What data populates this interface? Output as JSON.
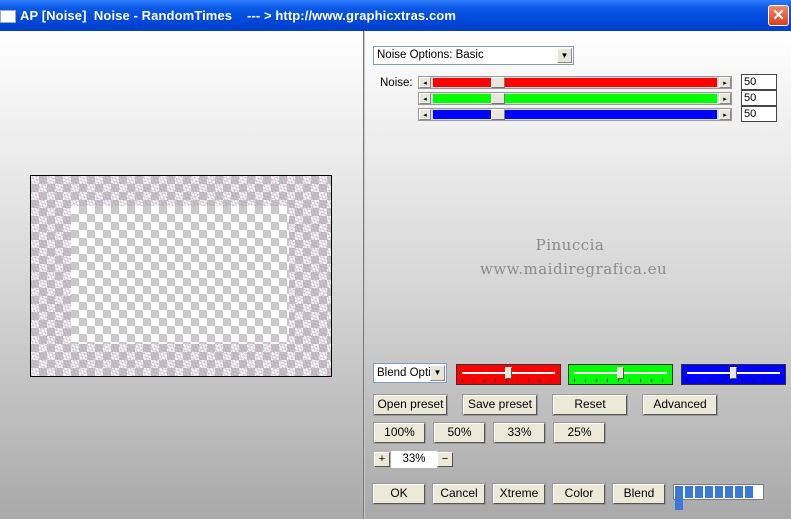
{
  "window": {
    "title": "AP [Noise]  Noise - RandomTimes    --- > http://www.graphicxtras.com",
    "close_symbol": "✕"
  },
  "noise_options": {
    "selected": "Noise Options: Basic"
  },
  "noise": {
    "label": "Noise:",
    "channels": [
      {
        "name": "red",
        "color": "#ff0000",
        "value": "50",
        "level": 0.22
      },
      {
        "name": "green",
        "color": "#00ff00",
        "value": "50",
        "level": 0.22
      },
      {
        "name": "blue",
        "color": "#0000ff",
        "value": "50",
        "level": 0.22
      }
    ]
  },
  "watermark": {
    "line1": "Pinuccia",
    "line2": "www.maidiregrafica.eu"
  },
  "blend_options": {
    "selected": "Blend Opti"
  },
  "color_sliders": [
    {
      "color": "#ff0000",
      "level": 0.5
    },
    {
      "color": "#00ff00",
      "level": 0.5
    },
    {
      "color": "#0000ff",
      "level": 0.5
    }
  ],
  "preset_buttons": {
    "open": "Open preset",
    "save": "Save preset",
    "reset": "Reset",
    "advanced": "Advanced"
  },
  "zoom_buttons": [
    "100%",
    "50%",
    "33%",
    "25%"
  ],
  "zoom": {
    "plus": "+",
    "value": "33%",
    "minus": "−"
  },
  "action_buttons": {
    "ok": "OK",
    "cancel": "Cancel",
    "xtreme": "Xtreme",
    "color": "Color",
    "blend": "Blend"
  },
  "progress": {
    "segments": 9,
    "filled": 9
  }
}
